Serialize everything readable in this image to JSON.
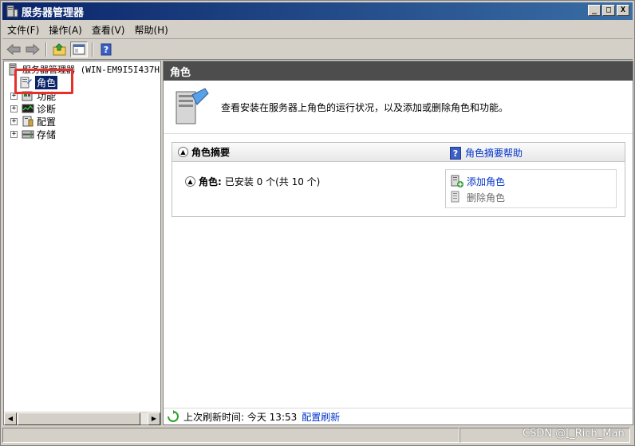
{
  "window": {
    "title": "服务器管理器",
    "controls": {
      "minimize": "_",
      "maximize": "□",
      "close": "X"
    }
  },
  "menubar": {
    "items": [
      {
        "label": "文件(F)"
      },
      {
        "label": "操作(A)"
      },
      {
        "label": "查看(V)"
      },
      {
        "label": "帮助(H)"
      }
    ]
  },
  "toolbar": {
    "icons": [
      "back-arrow-icon",
      "forward-arrow-icon",
      "up-folder-icon",
      "show-hide-console-tree-icon",
      "help-icon"
    ]
  },
  "tree": {
    "root": "服务器管理器 (WIN-EM9I5I437H",
    "items": [
      {
        "label": "角色",
        "selected": true,
        "icon": "roles-icon"
      },
      {
        "label": "功能",
        "icon": "features-icon"
      },
      {
        "label": "诊断",
        "icon": "diagnostics-icon"
      },
      {
        "label": "配置",
        "icon": "configuration-icon"
      },
      {
        "label": "存储",
        "icon": "storage-icon"
      }
    ]
  },
  "main": {
    "header": "角色",
    "description": "查看安装在服务器上角色的运行状况，以及添加或删除角色和功能。",
    "summary": {
      "title": "角色摘要",
      "help_link": "角色摘要帮助",
      "roles_label": "角色:",
      "roles_status": "已安装 0 个(共 10 个)",
      "actions": {
        "add": "添加角色",
        "remove": "删除角色"
      }
    },
    "footer": {
      "last_refresh_label": "上次刷新时间: 今天 13:53",
      "configure_refresh": "配置刷新"
    }
  },
  "watermark": "CSDN @[_Rich_Man",
  "colors": {
    "title_bar": "#0a246a",
    "pane_header": "#4d4d4d",
    "link": "#0033cc",
    "selection": "#0a246a",
    "highlight_box": "#e8302a"
  }
}
